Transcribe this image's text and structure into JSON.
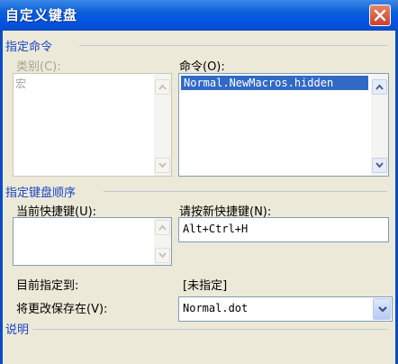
{
  "window": {
    "title": "自定义键盘"
  },
  "commands_group": {
    "title": "指定命令",
    "categories_label": "类别(C):",
    "categories_items": [
      "宏"
    ],
    "commands_label": "命令(O):",
    "commands_items": [
      "Normal.NewMacros.hidden"
    ]
  },
  "keys_group": {
    "title": "指定键盘顺序",
    "current_keys_label": "当前快捷键(U):",
    "current_keys_items": [],
    "new_key_label": "请按新快捷键(N):",
    "new_key_value": "Alt+Ctrl+H",
    "assigned_to_label": "目前指定到:",
    "assigned_to_value": "[未指定]",
    "save_in_label": "将更改保存在(V):",
    "save_in_value": "Normal.dot"
  },
  "description_group": {
    "title": "说明"
  },
  "icons": {
    "close": "close-icon",
    "scroll_up": "arrow-up-icon",
    "scroll_down": "arrow-down-icon",
    "dropdown": "chevron-down-icon"
  },
  "colors": {
    "titlebar": "#0054e3",
    "group_title": "#1a44c8",
    "selection": "#316ac5",
    "dialog_bg": "#ece9d8"
  }
}
